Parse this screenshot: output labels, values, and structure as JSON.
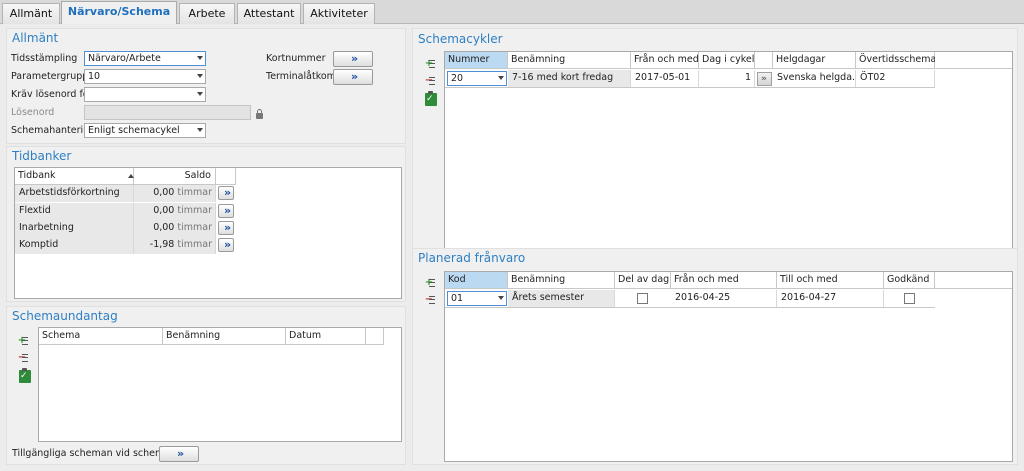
{
  "tabs": [
    "Allmänt",
    "Närvaro/Schema",
    "Arbete",
    "Attestant",
    "Aktiviteter"
  ],
  "allmant": {
    "title": "Allmänt",
    "tidsstampling_label": "Tidsstämpling",
    "tidsstampling_value": "Närvaro/Arbete",
    "parametergrupp_label": "Parametergrupp",
    "parametergrupp_value": "10",
    "krav_losenord_label": "Kräv lösenord för",
    "krav_losenord_value": "",
    "losenord_label": "Lösenord",
    "schemahantering_label": "Schemahantering",
    "schemahantering_value": "Enligt schemacykel",
    "kortnummer_label": "Kortnummer",
    "terminalatkomst_label": "Terminalåtkomst"
  },
  "tidbanker": {
    "title": "Tidbanker",
    "headers": [
      "Tidbank",
      "Saldo"
    ],
    "rows": [
      {
        "name": "Arbetstidsförkortning",
        "value": "0,00",
        "unit": "timmar"
      },
      {
        "name": "Flextid",
        "value": "0,00",
        "unit": "timmar"
      },
      {
        "name": "Inarbetning",
        "value": "0,00",
        "unit": "timmar"
      },
      {
        "name": "Komptid",
        "value": "-1,98",
        "unit": "timmar"
      }
    ]
  },
  "schemaundantag": {
    "title": "Schemaundantag",
    "headers": [
      "Schema",
      "Benämning",
      "Datum"
    ],
    "footer_label": "Tillgängliga scheman vid schemabyte"
  },
  "schemacykler": {
    "title": "Schemacykler",
    "headers": [
      "Nummer",
      "Benämning",
      "Från och med",
      "Dag i cykel",
      "Helgdagar",
      "Övertidsschema"
    ],
    "row": {
      "nummer": "20",
      "benamning": "7-16 med kort fredag",
      "fran": "2017-05-01",
      "dag": "1",
      "helgdagar": "Svenska helgda...",
      "overtid": "ÖT02"
    }
  },
  "planerad": {
    "title": "Planerad frånvaro",
    "headers": [
      "Kod",
      "Benämning",
      "Del av dag",
      "Från och med",
      "Till och med",
      "Godkänd"
    ],
    "row": {
      "kod": "01",
      "benamning": "Årets semester",
      "fran": "2016-04-25",
      "till": "2016-04-27"
    }
  }
}
